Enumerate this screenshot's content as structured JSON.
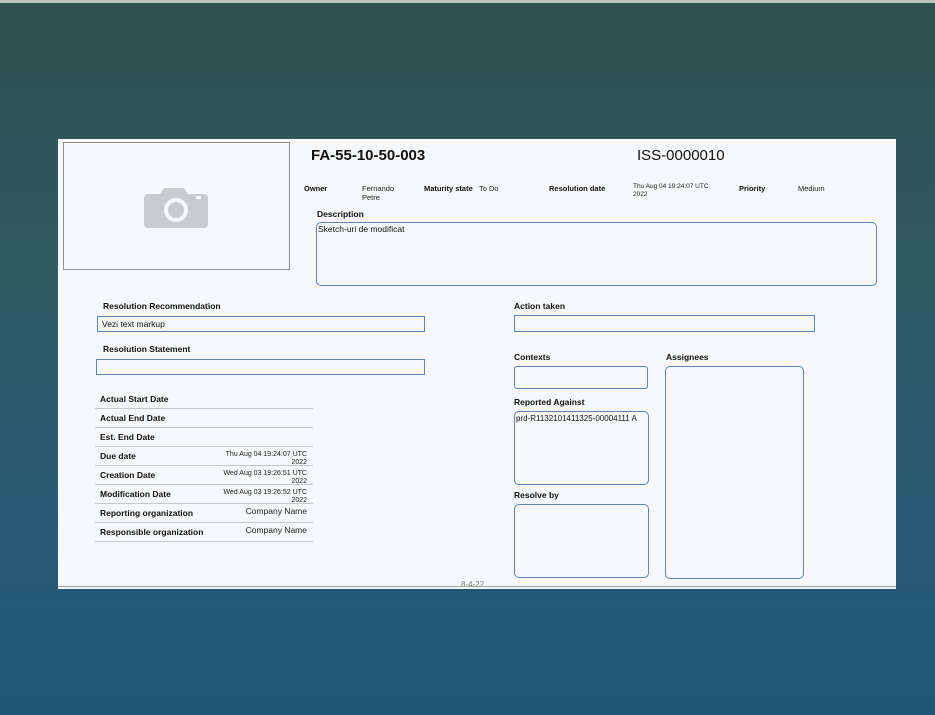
{
  "document": {
    "item_id": "FA-55-10-50-003",
    "issue_id": "ISS-0000010",
    "photo_icon": "camera-icon",
    "header_fields": {
      "owner_label": "Owner",
      "owner_value_line1": "Fernando",
      "owner_value_line2": "Petre",
      "maturity_label": "Maturity state",
      "maturity_value": "To Do",
      "resolution_date_label": "Resolution date",
      "resolution_date_line1": "Thu Aug 04 19:24:07 UTC",
      "resolution_date_line2": "2022",
      "priority_label": "Priority",
      "priority_value": "Medium"
    },
    "description": {
      "label": "Description",
      "text": "Sketch-uri de modificat"
    },
    "resolution_recommendation": {
      "label": "Resolution Recommendation",
      "text": "Vezi text markup"
    },
    "resolution_statement": {
      "label": "Resolution Statement",
      "text": ""
    },
    "action_taken": {
      "label": "Action taken",
      "text": ""
    },
    "contexts": {
      "label": "Contexts",
      "text": ""
    },
    "assignees": {
      "label": "Assignees",
      "text": ""
    },
    "reported_against": {
      "label": "Reported Against",
      "text": "prd-R1132101411325-00004111 A"
    },
    "resolve_by": {
      "label": "Resolve by",
      "text": ""
    },
    "dates": [
      {
        "label": "Actual Start Date",
        "value_line1": "",
        "value_line2": ""
      },
      {
        "label": "Actual End Date",
        "value_line1": "",
        "value_line2": ""
      },
      {
        "label": "Est. End Date",
        "value_line1": "",
        "value_line2": ""
      },
      {
        "label": "Due date",
        "value_line1": "Thu Aug 04 19:24:07 UTC",
        "value_line2": "2022"
      },
      {
        "label": "Creation Date",
        "value_line1": "Wed Aug 03 19:26:51 UTC",
        "value_line2": "2022"
      },
      {
        "label": "Modification Date",
        "value_line1": "Wed Aug 03 19:26:52 UTC",
        "value_line2": "2022"
      },
      {
        "label": "Reporting organization",
        "value_line1": "Company Name",
        "value_line2": ""
      },
      {
        "label": "Responsible organization",
        "value_line1": "Company Name",
        "value_line2": ""
      }
    ],
    "footer": "8-4-22"
  }
}
